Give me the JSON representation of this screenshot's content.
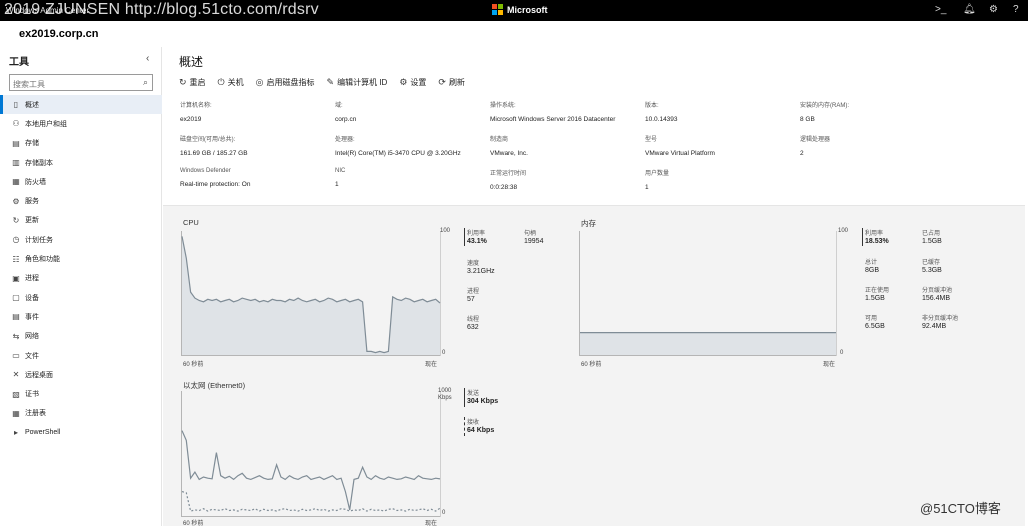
{
  "app": {
    "title": "Windows Admin Center",
    "watermark": "2019 ZJUNSEN http://blog.51cto.com/rdsrv",
    "brand": "Microsoft",
    "server": "ex2019.corp.cn",
    "corner_watermark": "@51CTO博客"
  },
  "sidebar": {
    "title": "工具",
    "search_placeholder": "搜索工具",
    "items": [
      {
        "label": "概述",
        "icon": "overview-icon"
      },
      {
        "label": "本地用户和组",
        "icon": "users-icon"
      },
      {
        "label": "存储",
        "icon": "storage-icon"
      },
      {
        "label": "存储副本",
        "icon": "storage-replica-icon"
      },
      {
        "label": "防火墙",
        "icon": "firewall-icon"
      },
      {
        "label": "服务",
        "icon": "services-icon"
      },
      {
        "label": "更新",
        "icon": "updates-icon"
      },
      {
        "label": "计划任务",
        "icon": "scheduled-tasks-icon"
      },
      {
        "label": "角色和功能",
        "icon": "roles-icon"
      },
      {
        "label": "进程",
        "icon": "processes-icon"
      },
      {
        "label": "设备",
        "icon": "devices-icon"
      },
      {
        "label": "事件",
        "icon": "events-icon"
      },
      {
        "label": "网络",
        "icon": "network-icon"
      },
      {
        "label": "文件",
        "icon": "files-icon"
      },
      {
        "label": "远程桌面",
        "icon": "remote-desktop-icon"
      },
      {
        "label": "证书",
        "icon": "certificates-icon"
      },
      {
        "label": "注册表",
        "icon": "registry-icon"
      },
      {
        "label": "PowerShell",
        "icon": "powershell-icon"
      }
    ]
  },
  "main": {
    "title": "概述",
    "actions": [
      {
        "label": "重启",
        "icon": "restart-icon"
      },
      {
        "label": "关机",
        "icon": "power-icon"
      },
      {
        "label": "启用磁盘指标",
        "icon": "disk-metrics-icon"
      },
      {
        "label": "编辑计算机 ID",
        "icon": "edit-icon"
      },
      {
        "label": "设置",
        "icon": "gear-icon"
      },
      {
        "label": "刷新",
        "icon": "refresh-icon"
      }
    ],
    "properties": [
      {
        "label": "计算机名称:",
        "value": "ex2019"
      },
      {
        "label": "域:",
        "value": "corp.cn"
      },
      {
        "label": "操作系统:",
        "value": "Microsoft Windows Server 2016 Datacenter"
      },
      {
        "label": "版本:",
        "value": "10.0.14393"
      },
      {
        "label": "安装的内存(RAM):",
        "value": "8 GB"
      },
      {
        "label": "磁盘空间(可用/总共):",
        "value": "161.69 GB / 185.27 GB"
      },
      {
        "label": "处理器:",
        "value": "Intel(R) Core(TM) i5-3470 CPU @ 3.20GHz"
      },
      {
        "label": "制造商",
        "value": "VMware, Inc."
      },
      {
        "label": "型号",
        "value": "VMware Virtual Platform"
      },
      {
        "label": "逻辑处理器",
        "value": "2"
      },
      {
        "label": "Windows Defender",
        "value": "Real-time protection: On"
      },
      {
        "label": "NIC",
        "value": "1"
      },
      {
        "label": "正常运行时间",
        "value": "0:0:28:38"
      },
      {
        "label": "用户数量",
        "value": "1"
      }
    ]
  },
  "chart_data": [
    {
      "type": "area",
      "title": "CPU",
      "ylim": [
        0,
        100
      ],
      "y_tick_labels": [
        "100",
        "0"
      ],
      "x_tick_labels": [
        "60 秒前",
        "现在"
      ],
      "x": [
        0,
        1,
        2,
        3,
        4,
        5,
        6,
        7,
        8,
        9,
        10,
        11,
        12,
        13,
        14,
        15,
        16,
        17,
        18,
        19,
        20,
        21,
        22,
        23,
        24,
        25,
        26,
        27,
        28,
        29,
        30,
        31,
        32,
        33,
        34,
        35,
        36,
        37,
        38,
        39,
        40,
        41,
        42,
        43,
        44,
        45,
        46,
        47,
        48,
        49,
        50,
        51,
        52,
        53,
        54,
        55,
        56,
        57,
        58,
        59,
        60
      ],
      "values": [
        98,
        80,
        52,
        47,
        45,
        44,
        46,
        45,
        46,
        44,
        45,
        46,
        44,
        45,
        47,
        46,
        45,
        46,
        44,
        45,
        44,
        46,
        45,
        45,
        44,
        46,
        45,
        47,
        45,
        44,
        45,
        46,
        44,
        45,
        47,
        46,
        44,
        45,
        46,
        44,
        45,
        46,
        44,
        3,
        3,
        2,
        3,
        2,
        3,
        48,
        46,
        45,
        47,
        46,
        44,
        45,
        46,
        44,
        45,
        46,
        43
      ],
      "stats": [
        {
          "label": "利用率",
          "value": "43.1%",
          "strong": true
        },
        {
          "label": "句柄",
          "value": "19954"
        },
        {
          "label": "速度",
          "value": "3.21GHz"
        },
        {
          "label": "进程",
          "value": "57"
        },
        {
          "label": "线程",
          "value": "632"
        }
      ]
    },
    {
      "type": "area",
      "title": "内存",
      "ylim": [
        0,
        100
      ],
      "y_tick_labels": [
        "100",
        "0"
      ],
      "x_tick_labels": [
        "60 秒前",
        "现在"
      ],
      "x": [
        0,
        60
      ],
      "values": [
        18.5,
        18.5
      ],
      "stats": [
        {
          "label": "利用率",
          "value": "18.53%",
          "strong": true
        },
        {
          "label": "已占用",
          "value": "1.5GB"
        },
        {
          "label": "总计",
          "value": "8GB"
        },
        {
          "label": "已缓存",
          "value": "5.3GB"
        },
        {
          "label": "正在使用",
          "value": "1.5GB"
        },
        {
          "label": "分页缓冲池",
          "value": "156.4MB"
        },
        {
          "label": "可用",
          "value": "6.5GB"
        },
        {
          "label": "非分页缓冲池",
          "value": "92.4MB"
        }
      ]
    },
    {
      "type": "line",
      "title": "以太网 (Ethernet0)",
      "ylim": [
        0,
        1000
      ],
      "y_tick_labels": [
        "1000",
        "Kbps",
        "0"
      ],
      "x_tick_labels": [
        "60 秒前",
        "现在"
      ],
      "x": [
        0,
        1,
        2,
        3,
        4,
        5,
        6,
        7,
        8,
        9,
        10,
        11,
        12,
        13,
        14,
        15,
        16,
        17,
        18,
        19,
        20,
        21,
        22,
        23,
        24,
        25,
        26,
        27,
        28,
        29,
        30,
        31,
        32,
        33,
        34,
        35,
        36,
        37,
        38,
        39,
        40,
        41,
        42,
        43,
        44,
        45,
        46,
        47,
        48,
        49,
        50,
        51,
        52,
        53,
        54,
        55,
        56,
        57,
        58,
        59,
        60
      ],
      "series": [
        {
          "name": "发送",
          "values": [
            700,
            620,
            310,
            360,
            300,
            320,
            310,
            305,
            520,
            330,
            310,
            325,
            300,
            330,
            350,
            310,
            300,
            315,
            330,
            310,
            300,
            305,
            420,
            320,
            300,
            330,
            310,
            300,
            320,
            330,
            300,
            310,
            320,
            300,
            315,
            330,
            300,
            310,
            200,
            50,
            300,
            310,
            400,
            320,
            300,
            330,
            310,
            300,
            320,
            310,
            300,
            305,
            320,
            310,
            300,
            330,
            310,
            305,
            300,
            310,
            304
          ],
          "color": "#7f8c96"
        },
        {
          "name": "接收",
          "values": [
            200,
            190,
            40,
            50,
            45,
            60,
            40,
            55,
            50,
            45,
            60,
            45,
            50,
            40,
            55,
            50,
            45,
            60,
            40,
            55,
            45,
            50,
            40,
            55,
            60,
            45,
            50,
            40,
            55,
            45,
            50,
            60,
            45,
            55,
            40,
            50,
            45,
            60,
            55,
            40,
            50,
            45,
            60,
            40,
            55,
            45,
            50,
            40,
            55,
            60,
            45,
            50,
            40,
            55,
            45,
            50,
            60,
            45,
            55,
            40,
            64
          ],
          "color": "#7f8c96",
          "dashed": true
        }
      ],
      "stats": [
        {
          "label": "发送",
          "value": "304 Kbps",
          "strong": true
        },
        {
          "label": "接收",
          "value": "64 Kbps",
          "strong": true
        }
      ]
    }
  ]
}
